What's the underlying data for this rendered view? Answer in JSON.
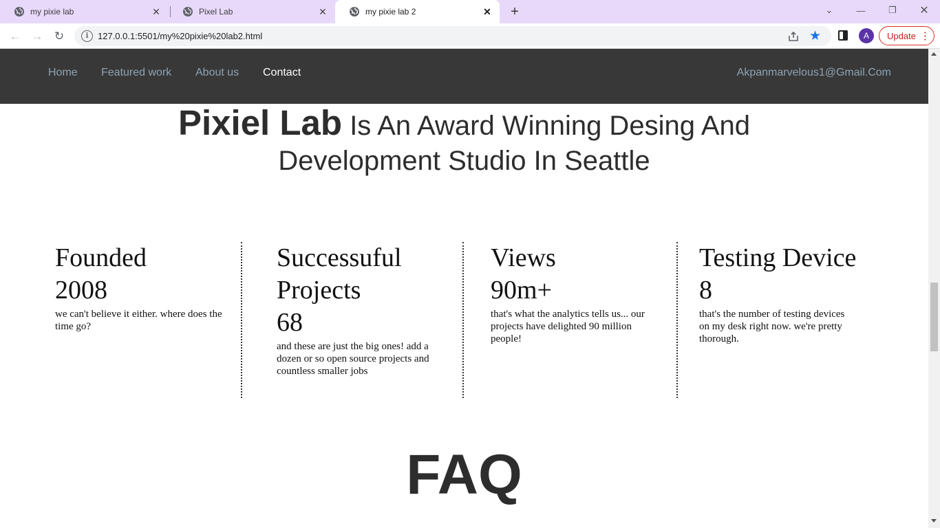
{
  "browser": {
    "tabs": [
      {
        "title": "my pixie lab",
        "active": false
      },
      {
        "title": "Pixel Lab",
        "active": false
      },
      {
        "title": "my pixie lab 2",
        "active": true
      }
    ],
    "url": "127.0.0.1:5501/my%20pixie%20lab2.html",
    "profile_initial": "A",
    "update_label": "Update",
    "colors": {
      "tabbar": "#e8d9fb",
      "accent": "#1a73e8",
      "update": "#d93025",
      "avatar": "#5b33a8"
    }
  },
  "site": {
    "nav": {
      "links": [
        "Home",
        "Featured work",
        "About us",
        "Contact"
      ],
      "active": "Contact",
      "email": "Akpanmarvelous1@Gmail.Com"
    },
    "hero": {
      "brand": "Pixiel Lab",
      "line1": "Is An Award Winning Desing And",
      "line2": "Development Studio In Seattle"
    },
    "stats": [
      {
        "title": "Founded",
        "value": "2008",
        "desc": "we can't believe it either. where does the time go?"
      },
      {
        "title": "Successuful Projects",
        "value": "68",
        "desc": "and these are just the big ones! add a dozen or so open source projects and countless smaller jobs"
      },
      {
        "title": "Views",
        "value": "90m+",
        "desc": "that's what the analytics tells us... our projects have delighted 90 million people!"
      },
      {
        "title": "Testing Device",
        "value": "8",
        "desc": "that's the number of testing devices on my desk right now. we're pretty thorough."
      }
    ],
    "faq_heading": "FAQ",
    "colors": {
      "nav_bg": "#383838",
      "nav_link": "#8ea3b3",
      "nav_active": "#ffffff",
      "heading": "#2d2d2d"
    }
  }
}
